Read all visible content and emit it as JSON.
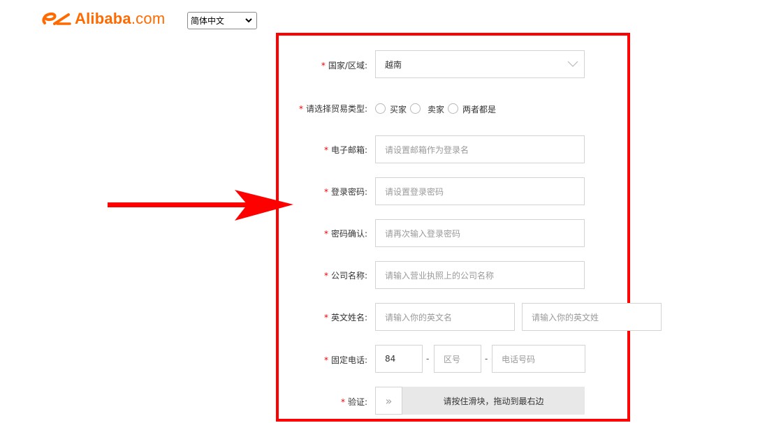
{
  "header": {
    "logo_main": "Alibaba",
    "logo_suffix": ".com",
    "language_selected": "简体中文"
  },
  "form": {
    "required_mark": "*",
    "country": {
      "label": "国家/区域:",
      "value": "越南"
    },
    "trade_type": {
      "label": "请选择贸易类型:",
      "options": [
        "买家",
        "卖家",
        "两者都是"
      ]
    },
    "email": {
      "label": "电子邮箱:",
      "placeholder": "请设置邮箱作为登录名"
    },
    "password": {
      "label": "登录密码:",
      "placeholder": "请设置登录密码"
    },
    "confirm_password": {
      "label": "密码确认:",
      "placeholder": "请再次输入登录密码"
    },
    "company": {
      "label": "公司名称:",
      "placeholder": "请输入营业执照上的公司名称"
    },
    "english_name": {
      "label": "英文姓名:",
      "first_placeholder": "请输入你的英文名",
      "last_placeholder": "请输入你的英文姓"
    },
    "phone": {
      "label": "固定电话:",
      "country_code": "84",
      "separator": "-",
      "area_placeholder": "区号",
      "number_placeholder": "电话号码"
    },
    "verify": {
      "label": "验证:",
      "slider_text": "请按住滑块，拖动到最右边",
      "handle_glyph": "»"
    }
  },
  "colors": {
    "brand": "#ff6a00",
    "highlight_box": "#ff0000",
    "required": "#e00000"
  }
}
